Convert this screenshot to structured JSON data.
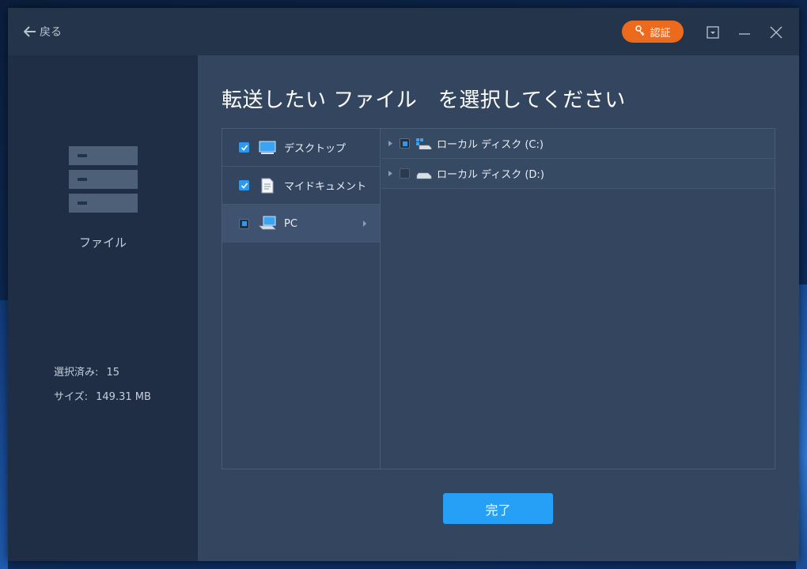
{
  "titlebar": {
    "back_label": "戻る",
    "auth_label": "認証",
    "accent_color": "#ec6a1c"
  },
  "sidebar": {
    "category_label": "ファイル",
    "selected_count_label": "選択済み:",
    "selected_count_value": "15",
    "size_label": "サイズ:",
    "size_value": "149.31 MB"
  },
  "main": {
    "title": "転送したい ファイル　を選択してください",
    "locations": [
      {
        "label": "デスクトップ",
        "state": "checked",
        "icon": "desktop-icon"
      },
      {
        "label": "マイドキュメント",
        "state": "checked",
        "icon": "document-icon"
      },
      {
        "label": "PC",
        "state": "partial",
        "icon": "pc-icon",
        "selected": true
      }
    ],
    "drives": [
      {
        "label": "ローカル ディスク (C:)",
        "state": "partial",
        "icon": "system-drive-icon"
      },
      {
        "label": "ローカル ディスク (D:)",
        "state": "empty",
        "icon": "drive-icon"
      }
    ],
    "done_label": "完了",
    "button_color": "#26a0f6"
  }
}
